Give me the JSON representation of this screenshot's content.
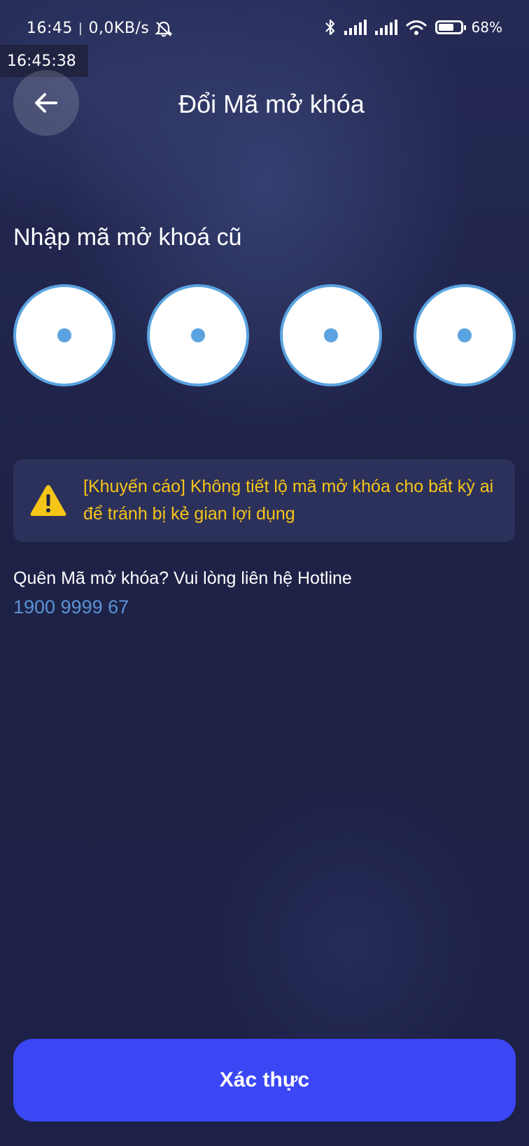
{
  "status_bar": {
    "time": "16:45",
    "network_speed": "0,0KB/s",
    "battery_percent": "68%",
    "battery_level": 0.68,
    "icons": [
      "mute-icon",
      "bluetooth-icon",
      "signal-icon",
      "signal-icon",
      "wifi-icon",
      "battery-icon"
    ]
  },
  "time_overlay": "16:45:38",
  "header": {
    "title": "Đổi Mã mở khóa",
    "back_icon": "arrow-left-icon"
  },
  "pin_entry": {
    "label": "Nhập mã mở khoá cũ",
    "digit_count": 4,
    "filled_count": 0
  },
  "warning": {
    "icon": "warning-icon",
    "text": "[Khuyến cáo] Không tiết lộ mã mở khóa cho bất kỳ ai để tránh bị kẻ gian lợi dụng",
    "color": "#f5c518"
  },
  "forgot": {
    "text": "Quên Mã mở khóa? Vui lòng liên hệ Hotline",
    "hotline": "1900 9999 67",
    "hotline_color": "#5b93d4"
  },
  "submit": {
    "label": "Xác thực",
    "color": "#3b47f5"
  }
}
